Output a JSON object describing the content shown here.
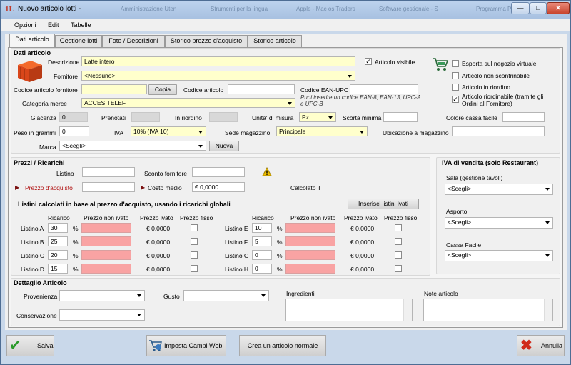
{
  "window": {
    "title": "Nuovo articolo lotti -",
    "ghost_tabs": [
      "Amministrazione Uten",
      "Strumenti per la lingua",
      "Apple - Mac os Traders",
      "Software gestionale - S",
      "Programma Pr"
    ]
  },
  "menu": [
    "Opzioni",
    "Edit",
    "Tabelle"
  ],
  "tabs": [
    "Dati articolo",
    "Gestione lotti",
    "Foto / Descrizioni",
    "Storico prezzo d'acquisto",
    "Storico articolo"
  ],
  "dati": {
    "title": "Dati articolo",
    "descrizione_label": "Descrizione",
    "descrizione": "Latte intero",
    "articolo_visibile": "Articolo visibile",
    "fornitore_label": "Fornitore",
    "fornitore": "<Nessuno>",
    "codice_fornitore_label": "Codice articolo fornitore",
    "copia": "Copia",
    "codice_articolo_label": "Codice articolo",
    "codice_ean_label": "Codice EAN-UPC",
    "ean_hint": "Puoi inserire un codice EAN-8, EAN-13, UPC-A e UPC-B",
    "categoria_label": "Categoria merce",
    "categoria": "ACCES.TELEF",
    "giacenza_label": "Giacenza",
    "giacenza": "0",
    "prenotati_label": "Prenotati",
    "in_riordino_label": "In riordino",
    "unita_label": "Unita' di misura",
    "unita": "Pz",
    "scorta_label": "Scorta minima",
    "colore_label": "Colore cassa facile",
    "peso_label": "Peso in grammi",
    "peso": "0",
    "iva_label": "IVA",
    "iva": "10% (IVA 10)",
    "sede_label": "Sede magazzino",
    "sede": "Principale",
    "ubicazione_label": "Ubicazione a magazzino",
    "marca_label": "Marca",
    "marca": "<Scegli>",
    "nuova": "Nuova",
    "options": [
      {
        "label": "Esporta sul negozio virtuale",
        "checked": false
      },
      {
        "label": "Articolo non scontrinabile",
        "checked": false
      },
      {
        "label": "Articolo in riordino",
        "checked": false
      },
      {
        "label": "Articolo riordinabile (tramite gli",
        "label2": "Ordini al Fornitore)",
        "checked": true
      }
    ]
  },
  "prezzi": {
    "title": "Prezzi / Ricarichi",
    "listino_label": "Listino",
    "sconto_label": "Sconto fornitore",
    "prezzo_acquisto_label": "Prezzo d'acquisto",
    "costo_medio_label": "Costo medio",
    "costo_medio": "€ 0,0000",
    "calcolato": "Calcolato il",
    "listini_title": "Listini calcolati in base al prezzo d'acquisto, usando i ricarichi globali",
    "inserisci": "Inserisci listini ivati",
    "headers": [
      "Ricarico",
      "Prezzo non ivato",
      "Prezzo ivato",
      "Prezzo fisso"
    ],
    "percent": "%",
    "left": [
      {
        "name": "Listino A",
        "ricarico": "30",
        "ivato": "€ 0,0000"
      },
      {
        "name": "Listino B",
        "ricarico": "25",
        "ivato": "€ 0,0000"
      },
      {
        "name": "Listino C",
        "ricarico": "20",
        "ivato": "€ 0,0000"
      },
      {
        "name": "Listino D",
        "ricarico": "15",
        "ivato": "€ 0,0000"
      }
    ],
    "right": [
      {
        "name": "Listino E",
        "ricarico": "10",
        "ivato": "€ 0,0000"
      },
      {
        "name": "Listino F",
        "ricarico": "5",
        "ivato": "€ 0,0000"
      },
      {
        "name": "Listino G",
        "ricarico": "0",
        "ivato": "€ 0,0000"
      },
      {
        "name": "Listino H",
        "ricarico": "0",
        "ivato": "€ 0,0000"
      }
    ]
  },
  "iva": {
    "title": "IVA di vendita (solo Restaurant)",
    "sala_label": "Sala (gestione tavoli)",
    "sala": "<Scegli>",
    "asporto_label": "Asporto",
    "asporto": "<Scegli>",
    "cassa_label": "Cassa Facile",
    "cassa": "<Scegli>"
  },
  "dettaglio": {
    "title": "Dettaglio Articolo",
    "provenienza_label": "Provenienza",
    "gusto_label": "Gusto",
    "ingredienti_label": "Ingredienti",
    "note_label": "Note articolo",
    "conservazione_label": "Conservazione"
  },
  "footer": {
    "salva": "Salva",
    "imposta": "Imposta Campi Web",
    "crea": "Crea un articolo normale",
    "annulla": "Annulla"
  },
  "colors": {
    "yellow": "#ffffcc",
    "pink": "#f9a3a3",
    "titlebar": "#bdd3ee"
  }
}
